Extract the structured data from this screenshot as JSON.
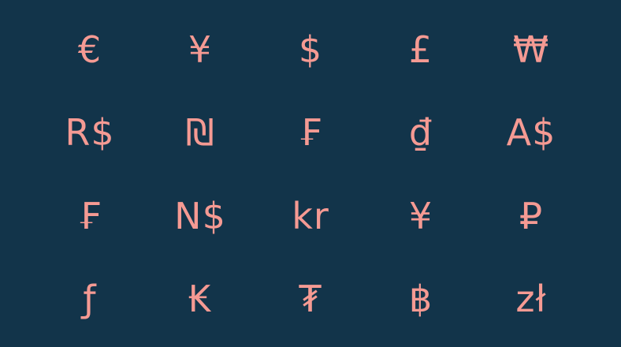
{
  "colors": {
    "background": "#12344a",
    "glyph": "#f59a93"
  },
  "symbols": [
    [
      "€",
      "¥",
      "$",
      "£",
      "₩"
    ],
    [
      "R$",
      "₪",
      "₣",
      "₫",
      "A$"
    ],
    [
      "₣",
      "N$",
      "kr",
      "¥",
      "₽"
    ],
    [
      "ƒ",
      "₭",
      "₮",
      "฿",
      "zł"
    ]
  ]
}
